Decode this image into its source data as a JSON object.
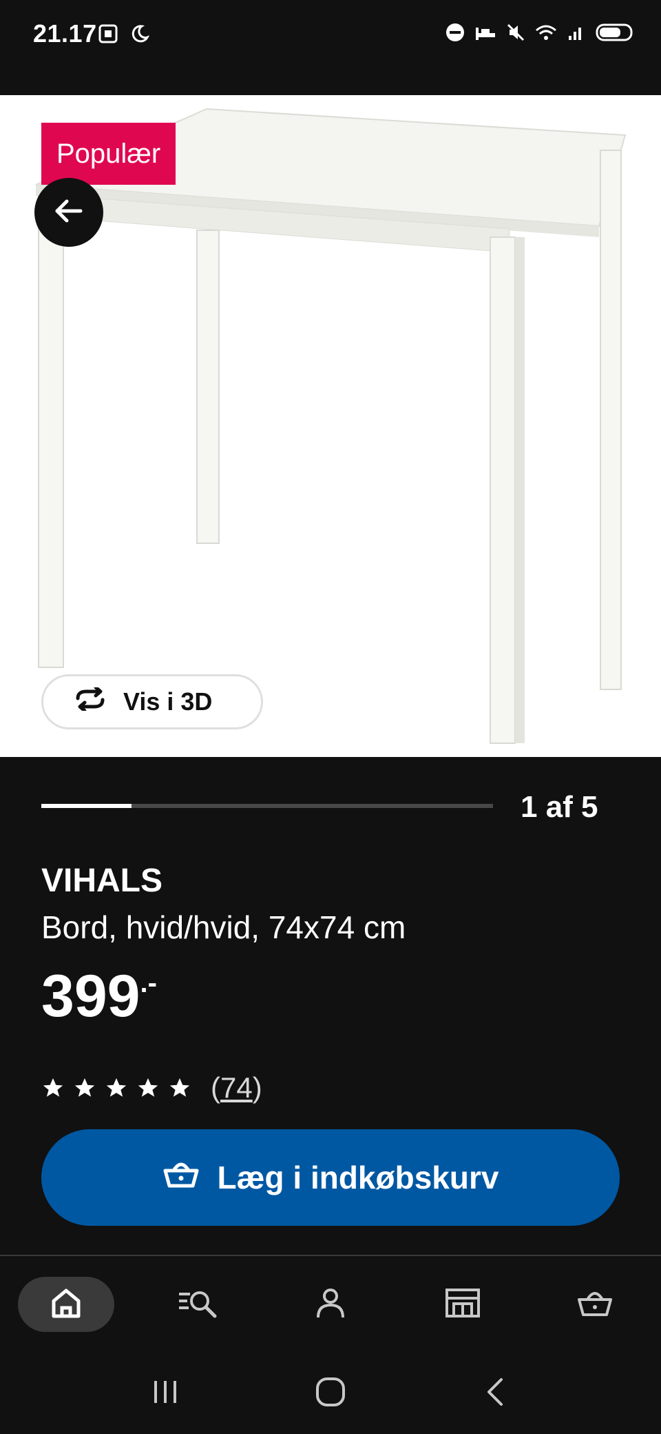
{
  "status_bar": {
    "time": "21.17",
    "left_icons": [
      "screenshot-icon",
      "moon-icon"
    ],
    "right_icons": [
      "dnd-icon",
      "bed-icon",
      "mute-icon",
      "wifi-icon",
      "signal-icon",
      "battery-icon"
    ]
  },
  "product_image": {
    "badge": "Populær",
    "view_3d_label": "Vis i 3D"
  },
  "gallery": {
    "counter": "1 af 5",
    "current": 1,
    "total": 5
  },
  "product": {
    "name": "VIHALS",
    "description": "Bord, hvid/hvid, 74x74 cm",
    "price": "399",
    "price_suffix": ".-",
    "rating_stars": 5,
    "review_count_open": "(",
    "review_count": "74",
    "review_count_close": ")"
  },
  "actions": {
    "add_to_cart_label": "Læg i indkøbskurv"
  },
  "bottom_nav": {
    "items": [
      "home-icon",
      "search-list-icon",
      "account-icon",
      "store-icon",
      "cart-icon"
    ],
    "active": "home-icon"
  },
  "system_nav": {
    "items": [
      "recents-icon",
      "home-circle-icon",
      "back-chevron-icon"
    ]
  },
  "colors": {
    "background": "#111111",
    "badge": "#e00751",
    "primary_button": "#0058a3",
    "image_bg": "#ffffff"
  }
}
